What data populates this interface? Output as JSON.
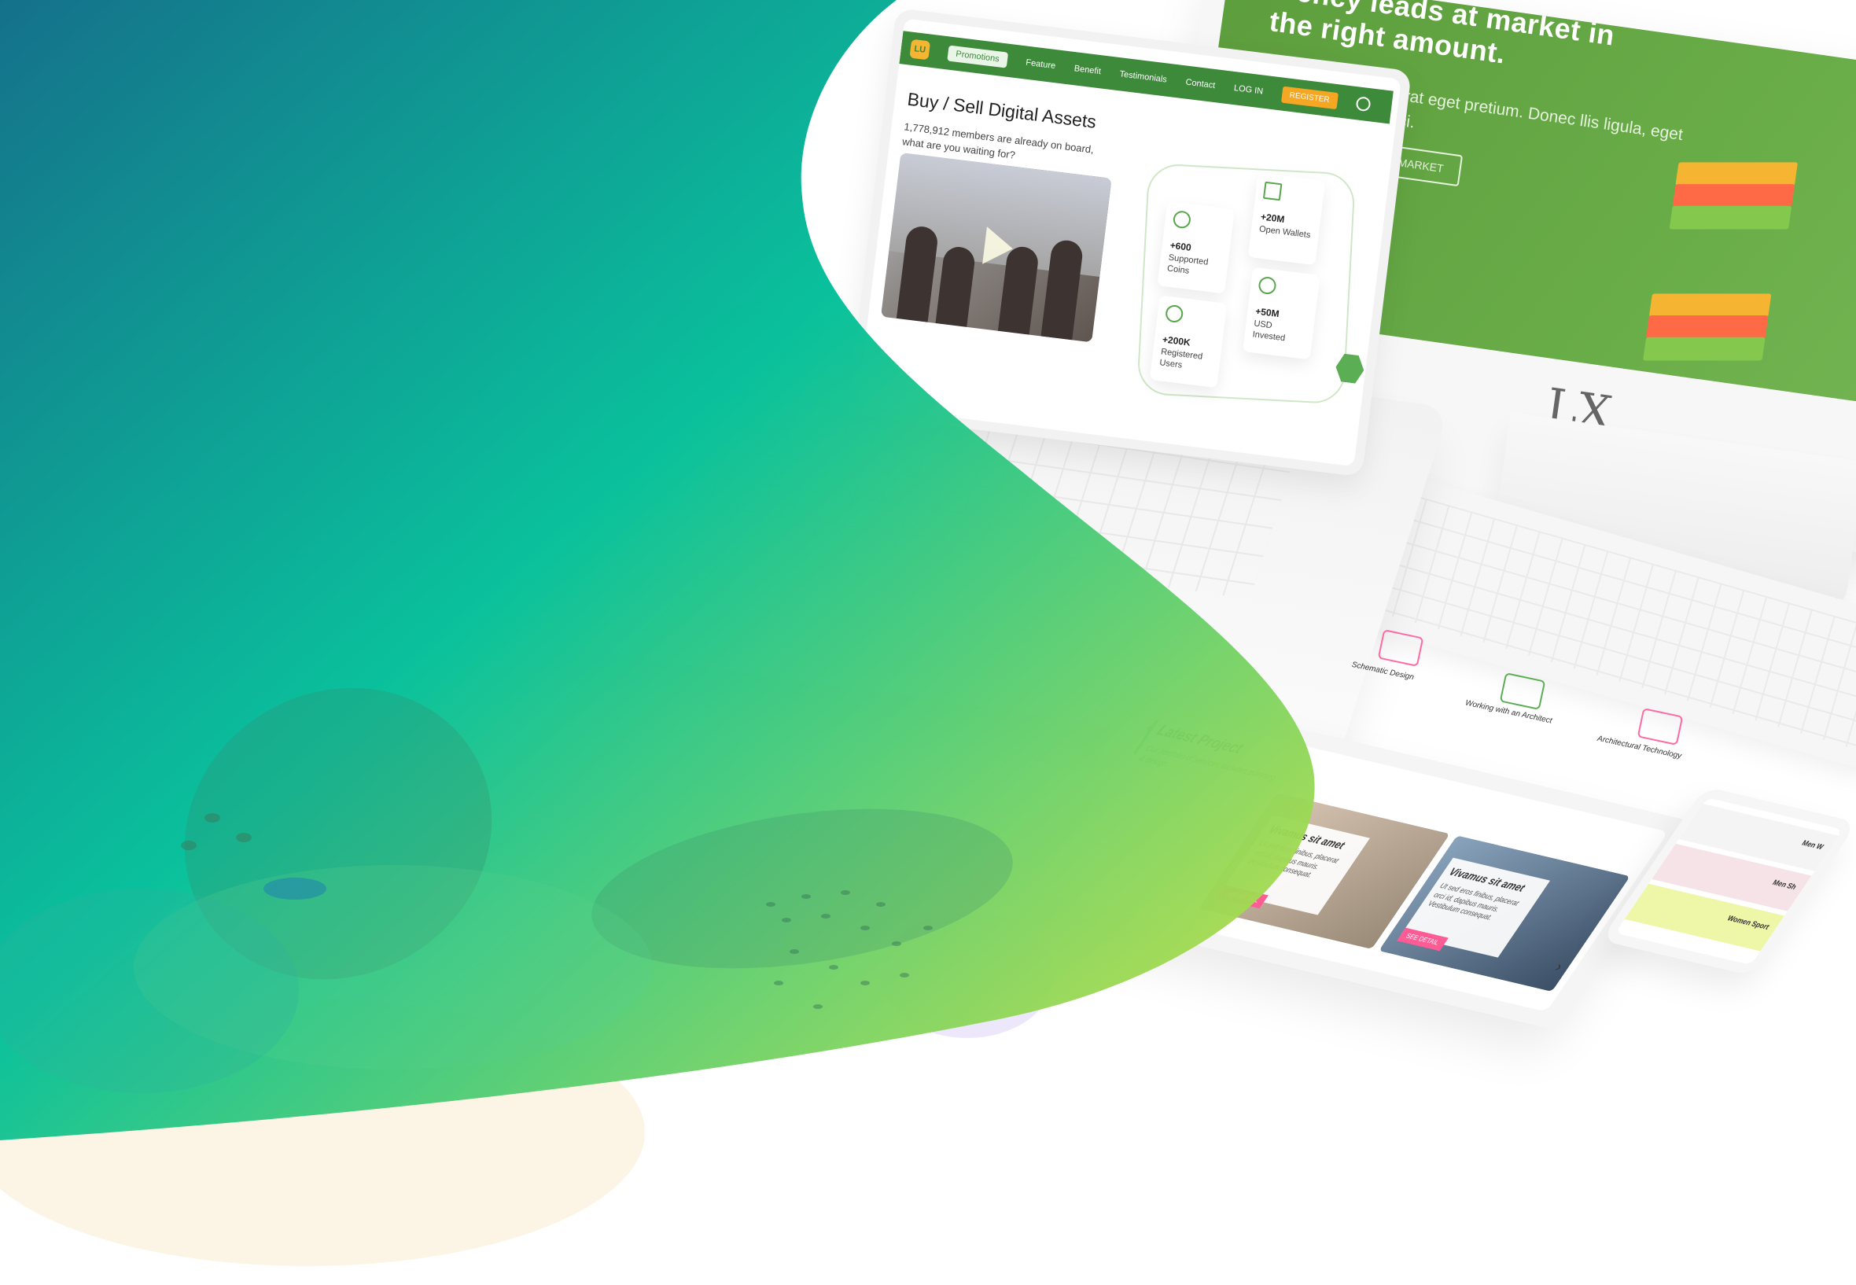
{
  "laptop": {
    "brand_badge": "LU",
    "nav": {
      "items": [
        "Promotions",
        "Feature",
        "Benefit",
        "Testimonials",
        "Contact"
      ],
      "login": "LOG IN",
      "register": "REGISTER"
    },
    "title": "Buy / Sell Digital Assets",
    "subtitle": "1,778,912 members are already on board, what are you waiting for?",
    "stats": [
      {
        "value": "+600",
        "label": "Supported Coins",
        "icon": "coin-icon"
      },
      {
        "value": "+20M",
        "label": "Open Wallets",
        "icon": "wallet-icon"
      },
      {
        "value": "+200K",
        "label": "Registered Users",
        "icon": "users-icon"
      },
      {
        "value": "+50M",
        "label": "USD Invested",
        "icon": "heart-icon"
      }
    ]
  },
  "monitor": {
    "hero_line1": "rrency leads at market in",
    "hero_line2": "the right amount.",
    "hero_sub": "bus eget erat eget pretium. Donec llis ligula, eget suscipit orci.",
    "cta": "VIEW MARKET"
  },
  "tablet": {
    "features": [
      "Schematic Design",
      "Working with an Architect",
      "Architectural Technology"
    ],
    "latest": {
      "title": "Latest Project",
      "subtitle": "Our portfolio of services includes planning & design"
    },
    "cards": [
      {
        "title": "Vivamus sit amet",
        "text": "Ut sed eros finibus, placerat orci id, dapibus mauris. Vestibulum consequat.",
        "button": "SEE DETAIL"
      },
      {
        "title": "Vivamus sit amet",
        "text": "Ut sed eros finibus, placerat orci id, dapibus mauris. Vestibulum consequat.",
        "button": "SEE DETAIL"
      }
    ]
  },
  "phone": {
    "rows": [
      {
        "label": "Men W"
      },
      {
        "label": "Men Sh"
      },
      {
        "label": "Women Sport"
      }
    ]
  },
  "colors": {
    "wave_start": "#0b6b86",
    "wave_mid": "#00bf98",
    "wave_end": "#d3e23c",
    "brand_green": "#3d8a3a",
    "accent_orange": "#f5a623",
    "accent_pink": "#ff5b95"
  }
}
